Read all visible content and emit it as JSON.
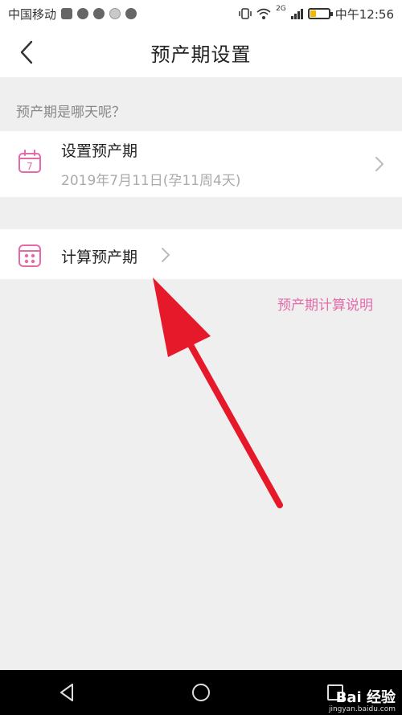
{
  "status_bar": {
    "carrier": "中国移动",
    "network": "2G",
    "time": "中午12:56"
  },
  "header": {
    "title": "预产期设置",
    "back_icon": "chevron-left-icon"
  },
  "section": {
    "question": "预产期是哪天呢？"
  },
  "set_due_date": {
    "label": "设置预产期",
    "value": "2019年7月11日(孕11周4天)",
    "icon": "calendar-7-icon",
    "day_number": "7"
  },
  "calc_due_date": {
    "label": "计算预产期",
    "icon": "calculator-grid-icon"
  },
  "explain_link": {
    "label": "预产期计算说明"
  },
  "annotation": {
    "color": "#e6192b"
  },
  "watermark": {
    "text": "Bai 经验",
    "sub": "jingyan.baidu.com"
  },
  "colors": {
    "accent": "#e56aa8",
    "background": "#efefef",
    "card": "#ffffff"
  }
}
